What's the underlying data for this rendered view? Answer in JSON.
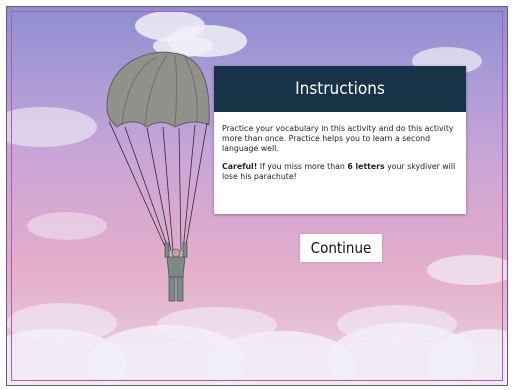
{
  "instructions": {
    "title": "Instructions",
    "paragraph1": "Practice your vocabulary in this activity and do this activity more than once. Practice helps you to learn a second language well.",
    "warning_label": "Careful!",
    "warning_text_before": " If you miss more than ",
    "letters_limit": "6 letters",
    "warning_text_after": " your skydiver will lose his parachute!"
  },
  "continue_label": "Continue",
  "colors": {
    "header_bg": "#173348",
    "sky_top": "#8e8ed0",
    "sky_bottom": "#ebd6e4",
    "parachute": "#8f918a"
  },
  "icons": {
    "parachute": "parachute-icon",
    "skydiver": "skydiver-figure"
  }
}
